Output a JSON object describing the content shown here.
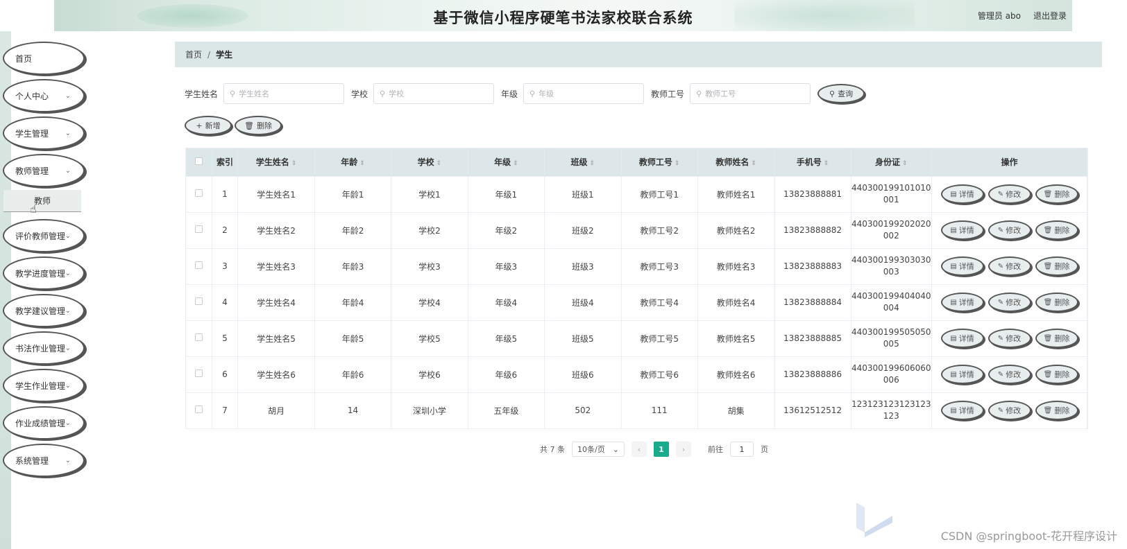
{
  "header": {
    "title": "基于微信小程序硬笔书法家校联合系统",
    "user_label": "管理员 abo",
    "logout_label": "退出登录"
  },
  "sidebar": {
    "items": [
      {
        "label": "首页",
        "has_children": false
      },
      {
        "label": "个人中心",
        "has_children": true
      },
      {
        "label": "学生管理",
        "has_children": true
      },
      {
        "label": "教师管理",
        "has_children": true,
        "expanded": true,
        "children": [
          "教师"
        ]
      },
      {
        "label": "评价教师管理",
        "has_children": true
      },
      {
        "label": "教学进度管理",
        "has_children": true
      },
      {
        "label": "教学建议管理",
        "has_children": true
      },
      {
        "label": "书法作业管理",
        "has_children": true
      },
      {
        "label": "学生作业管理",
        "has_children": true
      },
      {
        "label": "作业成绩管理",
        "has_children": true
      },
      {
        "label": "系统管理",
        "has_children": true
      }
    ]
  },
  "breadcrumb": {
    "home": "首页",
    "separator": "/",
    "current": "学生"
  },
  "search": {
    "fields": [
      {
        "label": "学生姓名",
        "placeholder": "学生姓名"
      },
      {
        "label": "学校",
        "placeholder": "学校"
      },
      {
        "label": "年级",
        "placeholder": "年级"
      },
      {
        "label": "教师工号",
        "placeholder": "教师工号"
      }
    ],
    "query_label": "查询"
  },
  "actions": {
    "add_label": "新增",
    "delete_label": "删除"
  },
  "table": {
    "columns": [
      "索引",
      "学生姓名",
      "年龄",
      "学校",
      "年级",
      "班级",
      "教师工号",
      "教师姓名",
      "手机号",
      "身份证",
      "操作"
    ],
    "sortable": [
      false,
      true,
      true,
      true,
      true,
      true,
      true,
      true,
      true,
      true,
      false
    ],
    "rows": [
      {
        "index": "1",
        "name": "学生姓名1",
        "age": "年龄1",
        "school": "学校1",
        "grade": "年级1",
        "class": "班级1",
        "teacher_no": "教师工号1",
        "teacher_name": "教师姓名1",
        "phone": "13823888881",
        "id_line1": "440300199101010",
        "id_line2": "001"
      },
      {
        "index": "2",
        "name": "学生姓名2",
        "age": "年龄2",
        "school": "学校2",
        "grade": "年级2",
        "class": "班级2",
        "teacher_no": "教师工号2",
        "teacher_name": "教师姓名2",
        "phone": "13823888882",
        "id_line1": "440300199202020",
        "id_line2": "002"
      },
      {
        "index": "3",
        "name": "学生姓名3",
        "age": "年龄3",
        "school": "学校3",
        "grade": "年级3",
        "class": "班级3",
        "teacher_no": "教师工号3",
        "teacher_name": "教师姓名3",
        "phone": "13823888883",
        "id_line1": "440300199303030",
        "id_line2": "003"
      },
      {
        "index": "4",
        "name": "学生姓名4",
        "age": "年龄4",
        "school": "学校4",
        "grade": "年级4",
        "class": "班级4",
        "teacher_no": "教师工号4",
        "teacher_name": "教师姓名4",
        "phone": "13823888884",
        "id_line1": "440300199404040",
        "id_line2": "004"
      },
      {
        "index": "5",
        "name": "学生姓名5",
        "age": "年龄5",
        "school": "学校5",
        "grade": "年级5",
        "class": "班级5",
        "teacher_no": "教师工号5",
        "teacher_name": "教师姓名5",
        "phone": "13823888885",
        "id_line1": "440300199505050",
        "id_line2": "005"
      },
      {
        "index": "6",
        "name": "学生姓名6",
        "age": "年龄6",
        "school": "学校6",
        "grade": "年级6",
        "class": "班级6",
        "teacher_no": "教师工号6",
        "teacher_name": "教师姓名6",
        "phone": "13823888886",
        "id_line1": "440300199606060",
        "id_line2": "006"
      },
      {
        "index": "7",
        "name": "胡月",
        "age": "14",
        "school": "深圳小学",
        "grade": "五年级",
        "class": "502",
        "teacher_no": "111",
        "teacher_name": "胡集",
        "phone": "13612512512",
        "id_line1": "123123123123123",
        "id_line2": "123"
      }
    ],
    "row_actions": {
      "detail": "详情",
      "edit": "修改",
      "delete": "删除"
    }
  },
  "pagination": {
    "total_text": "共 7 条",
    "page_size": "10条/页",
    "current_page": "1",
    "goto_prefix": "前往",
    "goto_value": "1",
    "goto_suffix": "页"
  },
  "watermark": "CSDN @springboot-花开程序设计"
}
